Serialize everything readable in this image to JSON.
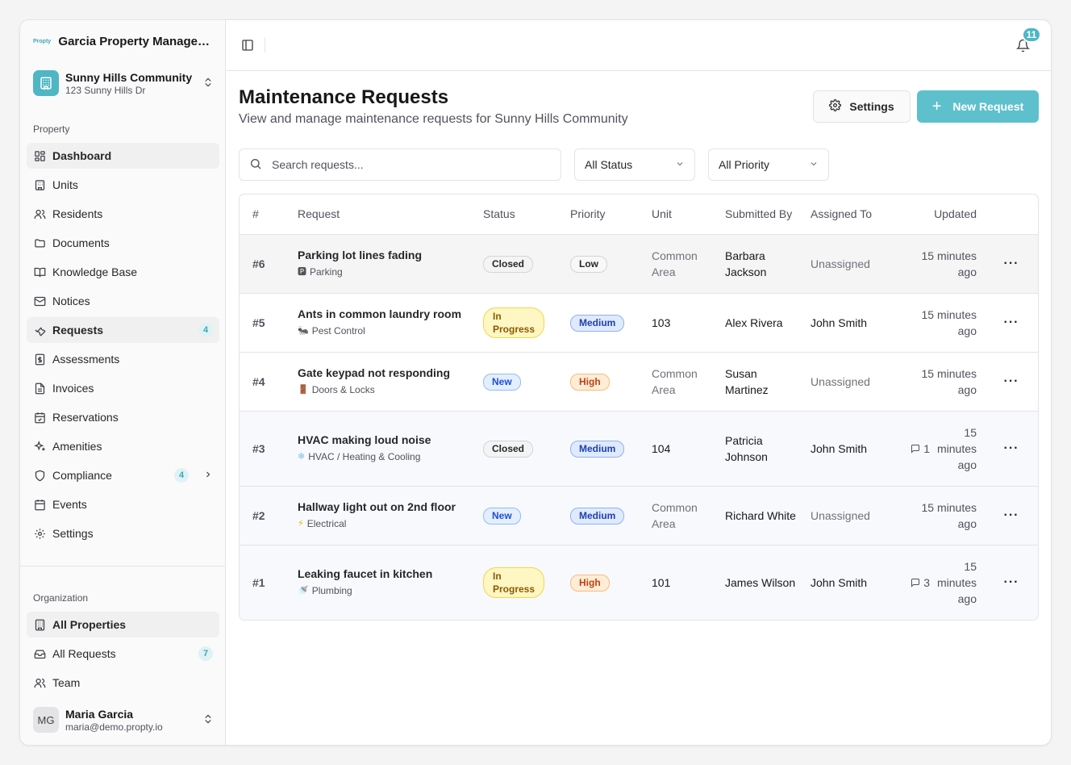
{
  "brand": {
    "logo_text": "Propty",
    "name": "Garcia Property Managem..."
  },
  "community": {
    "name": "Sunny Hills Community",
    "address": "123 Sunny Hills Dr"
  },
  "sidebar": {
    "property_label": "Property",
    "items": [
      {
        "label": "Dashboard",
        "icon": "dashboard-icon"
      },
      {
        "label": "Units",
        "icon": "building-icon"
      },
      {
        "label": "Residents",
        "icon": "users-icon"
      },
      {
        "label": "Documents",
        "icon": "folder-icon"
      },
      {
        "label": "Knowledge Base",
        "icon": "book-icon"
      },
      {
        "label": "Notices",
        "icon": "mail-icon"
      },
      {
        "label": "Requests",
        "icon": "wrench-icon",
        "badge": "4"
      },
      {
        "label": "Assessments",
        "icon": "dollar-icon"
      },
      {
        "label": "Invoices",
        "icon": "file-icon"
      },
      {
        "label": "Reservations",
        "icon": "calendar-check-icon"
      },
      {
        "label": "Amenities",
        "icon": "sparkle-icon"
      },
      {
        "label": "Compliance",
        "icon": "shield-icon",
        "badge": "4"
      },
      {
        "label": "Events",
        "icon": "calendar-icon"
      },
      {
        "label": "Settings",
        "icon": "gear-icon"
      }
    ],
    "org_label": "Organization",
    "org_items": [
      {
        "label": "All Properties",
        "icon": "building-icon"
      },
      {
        "label": "All Requests",
        "icon": "inbox-icon",
        "badge": "7"
      },
      {
        "label": "Team",
        "icon": "users-icon"
      }
    ]
  },
  "user": {
    "initials": "MG",
    "name": "Maria Garcia",
    "email": "maria@demo.propty.io"
  },
  "topbar": {
    "notifications": "11"
  },
  "page": {
    "title": "Maintenance Requests",
    "subtitle": "View and manage maintenance requests for Sunny Hills Community",
    "settings_label": "Settings",
    "new_request_label": "New Request"
  },
  "filters": {
    "search_placeholder": "Search requests...",
    "status": "All Status",
    "priority": "All Priority"
  },
  "table": {
    "headers": {
      "num": "#",
      "request": "Request",
      "status": "Status",
      "priority": "Priority",
      "unit": "Unit",
      "submitted_by": "Submitted By",
      "assigned_to": "Assigned To",
      "updated": "Updated"
    },
    "rows": [
      {
        "num": "#6",
        "title": "Parking lot lines fading",
        "cat_icon": "🅿",
        "category": "Parking",
        "status": "Closed",
        "priority": "Low",
        "unit": "Common Area",
        "submitted_by": "Barbara Jackson",
        "assigned_to": "Unassigned",
        "updated": "15 minutes ago",
        "comments": ""
      },
      {
        "num": "#5",
        "title": "Ants in common laundry room",
        "cat_icon": "🐜",
        "category": "Pest Control",
        "status": "In Progress",
        "priority": "Medium",
        "unit": "103",
        "submitted_by": "Alex Rivera",
        "assigned_to": "John Smith",
        "updated": "15 minutes ago",
        "comments": ""
      },
      {
        "num": "#4",
        "title": "Gate keypad not responding",
        "cat_icon": "🚪",
        "category": "Doors & Locks",
        "status": "New",
        "priority": "High",
        "unit": "Common Area",
        "submitted_by": "Susan Martinez",
        "assigned_to": "Unassigned",
        "updated": "15 minutes ago",
        "comments": ""
      },
      {
        "num": "#3",
        "title": "HVAC making loud noise",
        "cat_icon": "❄",
        "category": "HVAC / Heating & Cooling",
        "status": "Closed",
        "priority": "Medium",
        "unit": "104",
        "submitted_by": "Patricia Johnson",
        "assigned_to": "John Smith",
        "updated": "15 minutes ago",
        "comments": "1"
      },
      {
        "num": "#2",
        "title": "Hallway light out on 2nd floor",
        "cat_icon": "⚡",
        "category": "Electrical",
        "status": "New",
        "priority": "Medium",
        "unit": "Common Area",
        "submitted_by": "Richard White",
        "assigned_to": "Unassigned",
        "updated": "15 minutes ago",
        "comments": ""
      },
      {
        "num": "#1",
        "title": "Leaking faucet in kitchen",
        "cat_icon": "🚿",
        "category": "Plumbing",
        "status": "In Progress",
        "priority": "High",
        "unit": "101",
        "submitted_by": "James Wilson",
        "assigned_to": "John Smith",
        "updated": "15 minutes ago",
        "comments": "3"
      }
    ]
  },
  "colors": {
    "accent": "#5ec0cc",
    "accent_dark": "#3aa8b8"
  }
}
